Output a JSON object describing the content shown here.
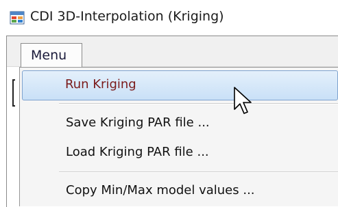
{
  "window": {
    "title": "CDI 3D-Interpolation (Kriging)",
    "icon": "app-window-icon"
  },
  "menubar": {
    "menu_label": "Menu"
  },
  "dropdown": {
    "items": [
      {
        "label": "Run Kriging",
        "highlighted": true
      },
      {
        "label": "Save Kriging PAR file ..."
      },
      {
        "label": "Load Kriging PAR file ..."
      },
      {
        "label": "Copy Min/Max model values ..."
      }
    ]
  },
  "colors": {
    "highlight_border": "#7da2ce",
    "highlight_fill": "#c9e0f7",
    "highlight_text": "#7a1a1a",
    "menu_background": "#f5f5f5"
  },
  "cursor": "arrow-pointer-icon"
}
